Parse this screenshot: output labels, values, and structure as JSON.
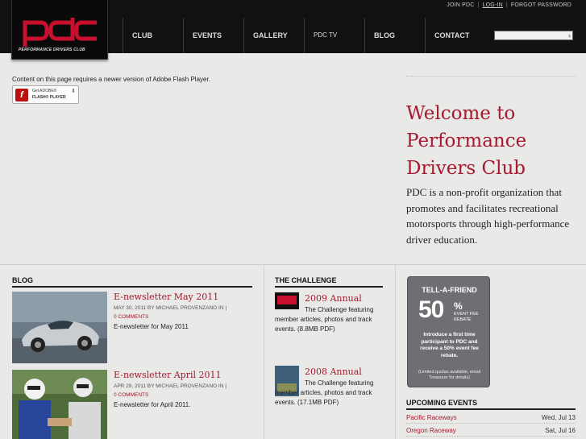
{
  "header": {
    "top_links": [
      "JOIN PDC",
      "LOG-IN",
      "FORGOT PASSWORD"
    ],
    "logo_text": "pdc",
    "logo_subtext": "PERFORMANCE DRIVERS CLUB",
    "nav": [
      "CLUB",
      "EVENTS",
      "GALLERY",
      "PDC TV",
      "BLOG",
      "CONTACT"
    ],
    "search_placeholder": ""
  },
  "flash": {
    "message": "Content on this page requires a newer version of Adobe Flash Player.",
    "button_line1": "Get ADOBE®",
    "button_line2": "FLASH® PLAYER"
  },
  "welcome": {
    "heading": "Welcome to Performance Drivers Club",
    "intro": "PDC is a non-profit organization that promotes and facilitates recreational motorsports through high-performance driver education."
  },
  "blog": {
    "heading": "BLOG",
    "posts": [
      {
        "title": "E-newsletter May 2011",
        "meta": "MAY 30, 2011 BY MICHAEL PROVENZANO IN |",
        "comments": "0 COMMENTS",
        "desc": "E-newsletter for May 2011"
      },
      {
        "title": "E-newsletter April 2011",
        "meta": "APR 29, 2011 BY MICHAEL PROVENZANO IN |",
        "comments": "0 COMMENTS",
        "desc": "E-newsletter for April 2011."
      }
    ]
  },
  "challenge": {
    "heading": "THE CHALLENGE",
    "items": [
      {
        "title": "2009 Annual",
        "text": "The Challenge featuring member articles, photos and track events. (8.8MB PDF)"
      },
      {
        "title": "2008 Annual",
        "text": "The Challenge featuring member articles, photos and track events. (17.1MB PDF)"
      }
    ]
  },
  "promo": {
    "heading": "TELL-A-FRIEND",
    "big": "50",
    "pct": "%",
    "ev_text": "EVENT FEE REBATE",
    "body": "Introduce a first time participant to PDC and receive a 50% event fee rebate.",
    "foot": "(Limited quotas available, email Treasurer for details)"
  },
  "upcoming": {
    "heading": "UPCOMING EVENTS",
    "events": [
      {
        "name": "Pacific Raceways",
        "date": "Wed, Jul 13"
      },
      {
        "name": "Oregon Raceway",
        "date": "Sat, Jul 16"
      }
    ]
  },
  "colors": {
    "brand_red": "#a6192e",
    "header_black": "#111111",
    "page_bg": "#e9e9e7"
  }
}
